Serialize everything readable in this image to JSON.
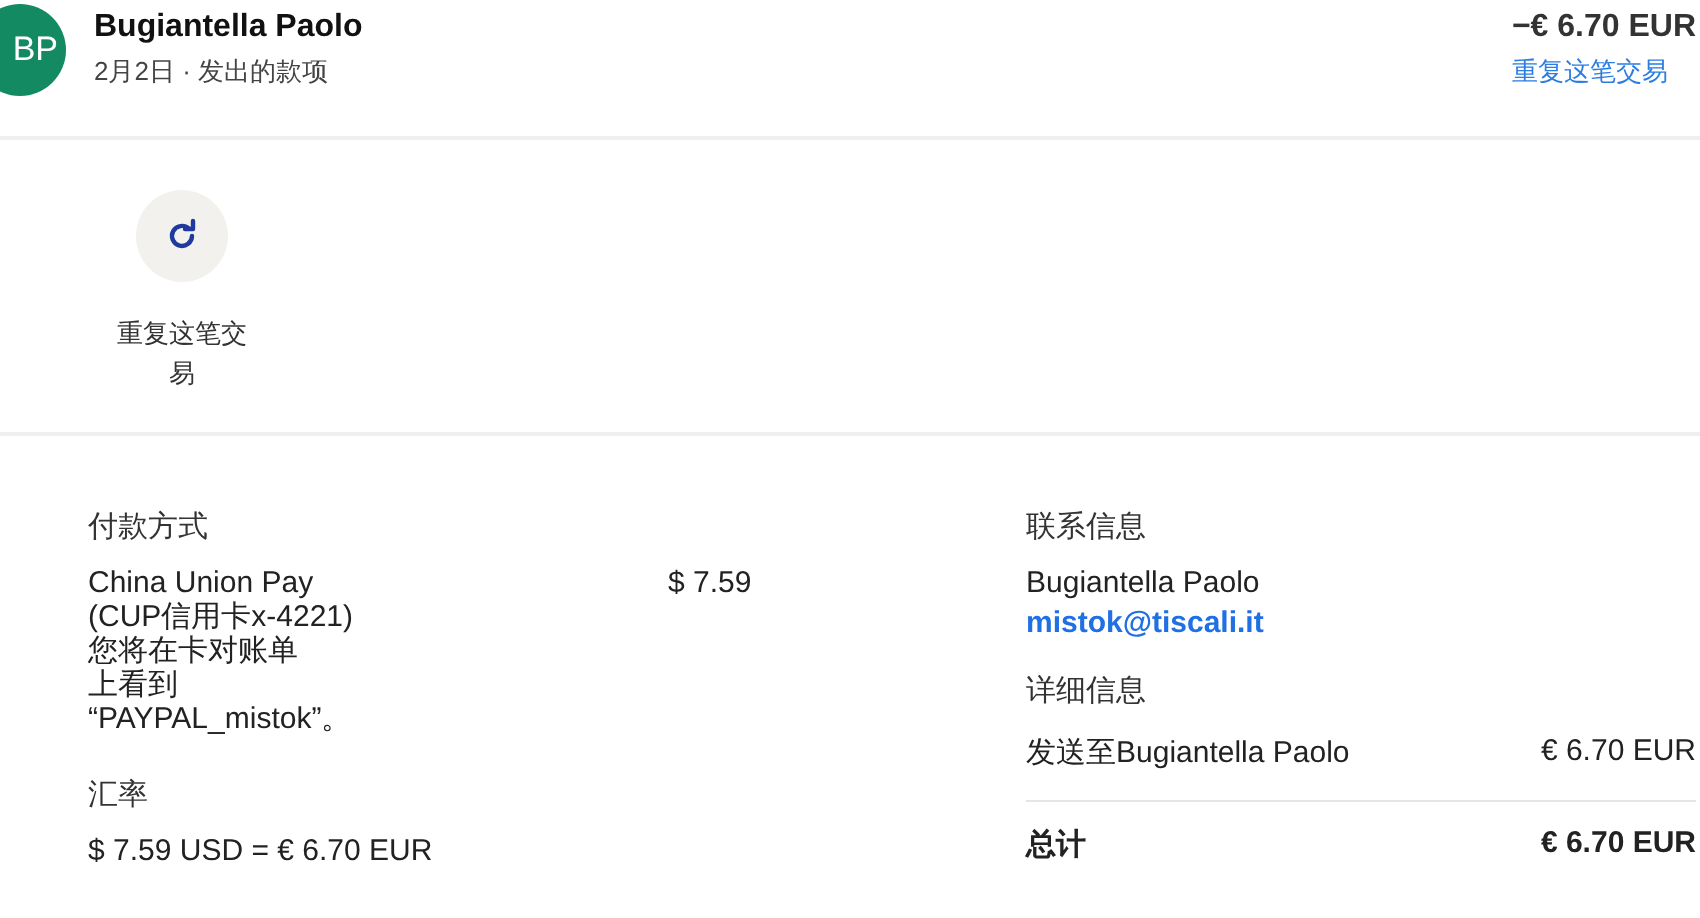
{
  "header": {
    "avatar_initials": "BP",
    "name": "Bugiantella Paolo",
    "subtitle": "2月2日 · 发出的款项",
    "amount": "−€ 6.70 EUR",
    "repeat_link": "重复这笔交易"
  },
  "actions": [
    {
      "kind": "repeat",
      "label": "重复这笔交易"
    }
  ],
  "payment": {
    "title": "付款方式",
    "method_lines": [
      "China Union Pay",
      "(CUP信用卡x-4221)",
      "您将在卡对账单",
      "上看到",
      "“PAYPAL_mistok”。"
    ],
    "amount": "$ 7.59"
  },
  "exchange": {
    "title": "汇率",
    "value": "$ 7.59 USD = € 6.70 EUR"
  },
  "contact": {
    "title": "联系信息",
    "name": "Bugiantella Paolo",
    "email": "mistok@tiscali.it"
  },
  "details": {
    "title": "详细信息",
    "rows": [
      {
        "label": "发送至Bugiantella Paolo",
        "value": "€ 6.70 EUR"
      }
    ],
    "total_label": "总计",
    "total_value": "€ 6.70 EUR"
  }
}
